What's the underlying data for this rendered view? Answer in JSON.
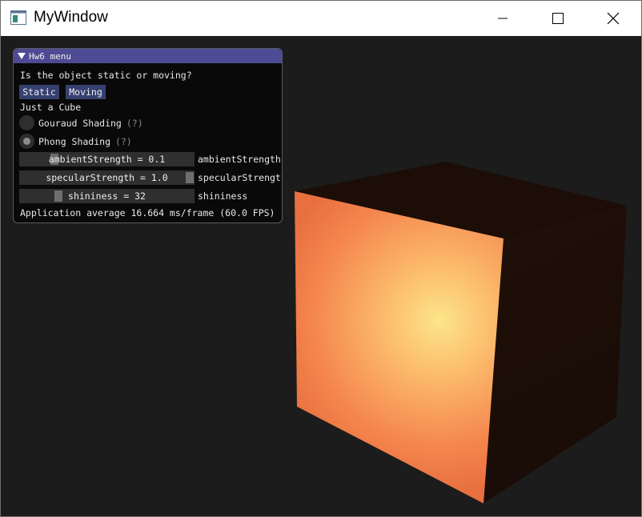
{
  "window": {
    "title": "MyWindow",
    "controls": {
      "minimize": "minimize-icon",
      "maximize": "maximize-icon",
      "close": "close-icon"
    }
  },
  "panel": {
    "title": "Hw6 menu",
    "question": "Is the object static or moving?",
    "buttons": {
      "static": "Static",
      "moving": "Moving"
    },
    "subtitle": "Just a Cube",
    "radios": [
      {
        "label": "Gouraud Shading",
        "help": "(?)",
        "selected": false
      },
      {
        "label": "Phong Shading",
        "help": "(?)",
        "selected": true
      }
    ],
    "sliders": [
      {
        "text": "ambientStrength = 0.1",
        "label": "ambientStrength",
        "value": 0.1,
        "min": 0,
        "max": 1
      },
      {
        "text": "specularStrength = 1.0",
        "label": "specularStrength",
        "value": 1.0,
        "min": 0,
        "max": 1
      },
      {
        "text": "shininess = 32",
        "label": "shininess",
        "value": 32,
        "min": 0,
        "max": 256
      }
    ],
    "fps_text": "Application average 16.664 ms/frame (60.0 FPS)"
  },
  "colors": {
    "header": "#4d4b94",
    "button": "#36406f",
    "cube_highlight": "#fde58a",
    "cube_base": "#ef7240",
    "cube_side": "#1f0f08"
  }
}
